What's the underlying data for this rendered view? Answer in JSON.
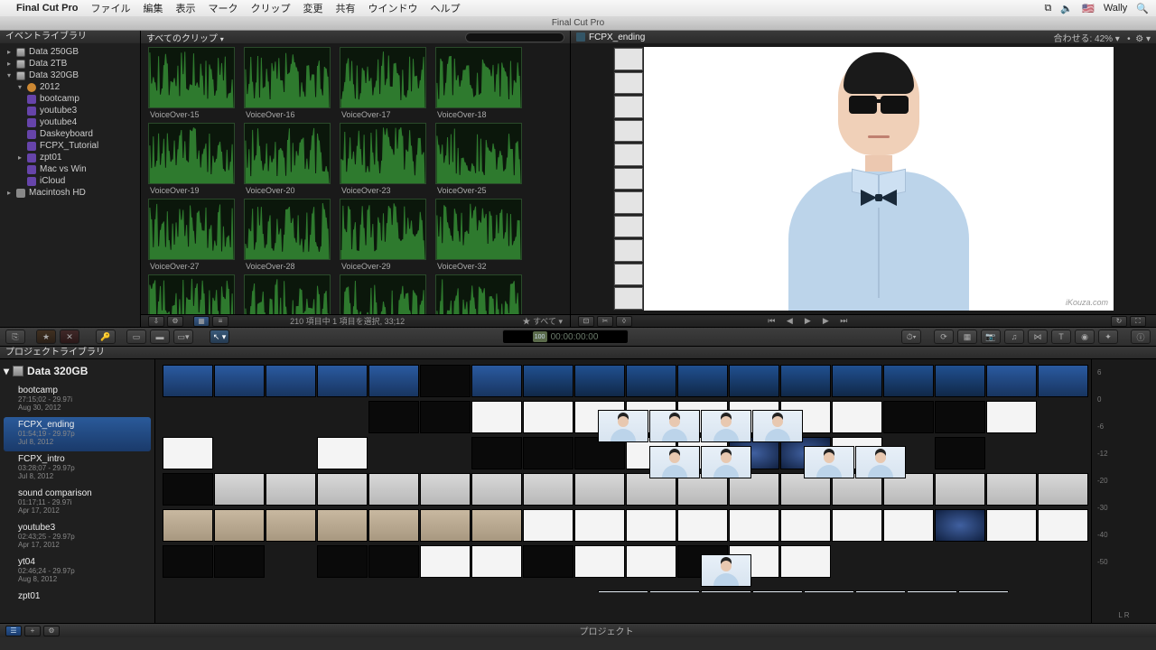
{
  "menubar": {
    "app": "Final Cut Pro",
    "items": [
      "ファイル",
      "編集",
      "表示",
      "マーク",
      "クリップ",
      "変更",
      "共有",
      "ウインドウ",
      "ヘルプ"
    ],
    "user": "Wally"
  },
  "window_title": "Final Cut Pro",
  "event_library": {
    "title": "イベントライブラリ",
    "drives": [
      "Data 250GB",
      "Data 2TB",
      "Data 320GB"
    ],
    "year": "2012",
    "events": [
      "bootcamp",
      "youtube3",
      "youtube4",
      "Daskeyboard",
      "FCPX_Tutorial",
      "zpt01",
      "Mac vs Win",
      "iCloud"
    ],
    "mac": "Macintosh HD"
  },
  "browser": {
    "title": "すべてのクリップ",
    "clips": [
      "VoiceOver-15",
      "VoiceOver-16",
      "VoiceOver-17",
      "VoiceOver-18",
      "VoiceOver-19",
      "VoiceOver-20",
      "VoiceOver-23",
      "VoiceOver-25",
      "VoiceOver-27",
      "VoiceOver-28",
      "VoiceOver-29",
      "VoiceOver-32",
      "",
      "",
      "",
      ""
    ],
    "status": "210 項目中 1 項目を選択, 33;12",
    "filter": "すべて"
  },
  "viewer": {
    "clip": "FCPX_ending",
    "fit_label": "合わせる:",
    "fit_value": "42%",
    "watermark": "iKouza.com"
  },
  "timecode": {
    "badge": "100",
    "value": "00:00:00:00"
  },
  "project_library": {
    "title": "プロジェクトライブラリ",
    "drive": "Data 320GB",
    "projects": [
      {
        "name": "bootcamp",
        "meta": "27:15;02 - 29.97i",
        "date": "Aug 30, 2012"
      },
      {
        "name": "FCPX_ending",
        "meta": "01:54;19 - 29.97p",
        "date": "Jul 8, 2012"
      },
      {
        "name": "FCPX_intro",
        "meta": "03:28;07 - 29.97p",
        "date": "Jul 8, 2012"
      },
      {
        "name": "sound comparison",
        "meta": "01:17;11 - 29.97i",
        "date": "Apr 17, 2012"
      },
      {
        "name": "youtube3",
        "meta": "02:43;25 - 29.97p",
        "date": "Apr 17, 2012"
      },
      {
        "name": "yt04",
        "meta": "02:46;24 - 29.97p",
        "date": "Aug 8, 2012"
      },
      {
        "name": "zpt01",
        "meta": "",
        "date": ""
      }
    ]
  },
  "audio": {
    "ticks": [
      "6",
      "0",
      "-6",
      "-12",
      "-20",
      "-30",
      "-40",
      "-50"
    ],
    "lr": "L          R"
  },
  "bottom": {
    "label": "プロジェクト"
  }
}
